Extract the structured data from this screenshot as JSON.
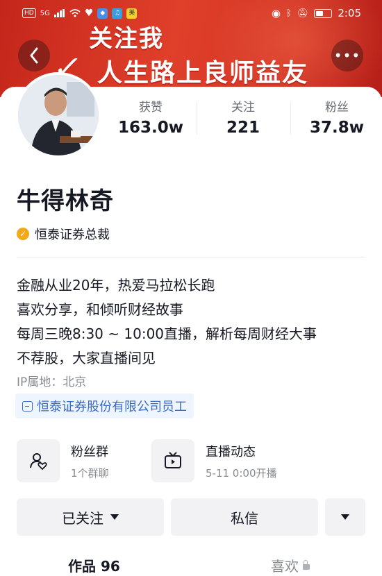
{
  "status_bar": {
    "left_chips": [
      "HD",
      "5G"
    ],
    "app_badge": "美",
    "time": "2:05"
  },
  "banner": {
    "line1": "关注我",
    "line2": "人生路上良师益友"
  },
  "nav": {
    "back_icon": "chevron-left-icon",
    "more_icon": "more-dots-icon"
  },
  "profile": {
    "nickname": "牛得林奇",
    "verification": "恒泰证券总裁",
    "bio": [
      "金融从业20年，热爱马拉松长跑",
      "喜欢分享，和倾听财经故事",
      "每周三晚8:30 ~ 10:00直播，解析每周财经大事",
      "不荐股，大家直播间见"
    ],
    "ip_location": "IP属地：北京",
    "company": "恒泰证券股份有限公司员工"
  },
  "stats": [
    {
      "label": "获赞",
      "value": "163.0w"
    },
    {
      "label": "关注",
      "value": "221"
    },
    {
      "label": "粉丝",
      "value": "37.8w"
    }
  ],
  "features": [
    {
      "title": "粉丝群",
      "subtitle": "1个群聊",
      "icon": "fan-group-icon"
    },
    {
      "title": "直播动态",
      "subtitle": "5-11 0:00开播",
      "icon": "live-tv-icon"
    }
  ],
  "actions": {
    "follow_label": "已关注",
    "message_label": "私信"
  },
  "tabs": [
    {
      "label": "作品 96"
    },
    {
      "label": "喜欢"
    }
  ],
  "colors": {
    "banner_red": "#d23425",
    "verify_badge": "#f3a81b",
    "company_tag_text": "#3a6cc3",
    "button_bg": "#f2f2f4"
  }
}
